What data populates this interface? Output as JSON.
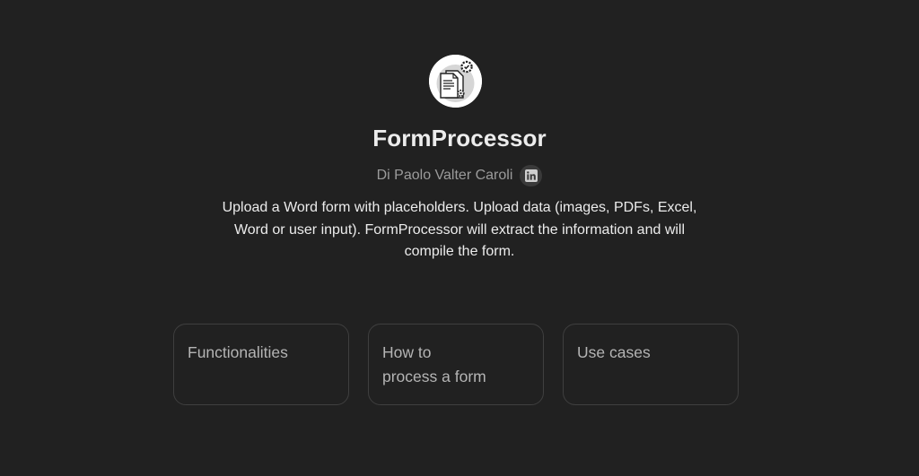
{
  "gpt": {
    "name": "FormProcessor",
    "author": "Di Paolo Valter Caroli",
    "author_link_icon": "linkedin-icon",
    "description": "Upload a Word form with placeholders. Upload data (images, PDFs, Excel, Word or user input). FormProcessor will extract the information and will compile the form.",
    "logo_icon": "document-gear-icon"
  },
  "starters": [
    {
      "line1": "Functionalities",
      "line2": ""
    },
    {
      "line1": "How to",
      "line2": "process a form"
    },
    {
      "line1": "Use cases",
      "line2": ""
    }
  ],
  "colors": {
    "background": "#212121",
    "text": "#ececec",
    "muted": "#9b9b9b",
    "card_border": "#3f3f3f"
  }
}
